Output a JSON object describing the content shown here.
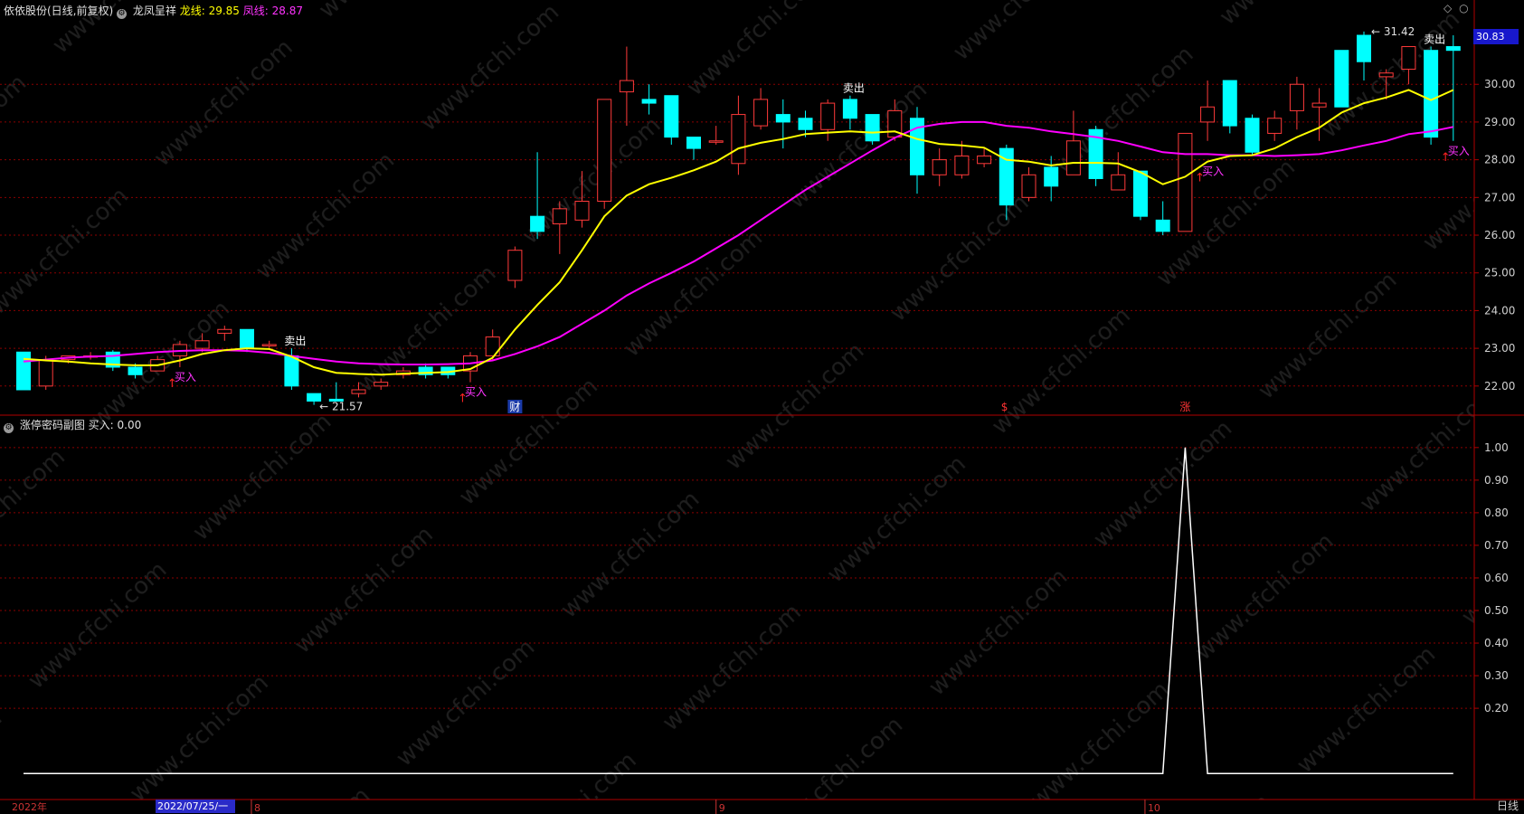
{
  "header": {
    "stock": "依依股份(日线,前复权)",
    "indicator": "龙凤呈祥",
    "dragon_label": "龙线:",
    "dragon_value": "29.85",
    "phoenix_label": "凤线:",
    "phoenix_value": "28.87"
  },
  "sub_header": {
    "indicator": "涨停密码副图",
    "buy_label": "买入:",
    "buy_value": "0.00"
  },
  "current_price": "30.83",
  "timeframe": "日线",
  "x_axis": {
    "year": "2022年",
    "cursor_date": "2022/07/25/一",
    "months": [
      "8",
      "9",
      "10"
    ]
  },
  "watermark": "www.cfchi.com",
  "colors": {
    "up": "#ff3a3a",
    "down": "#00ffff",
    "dragon": "#ffff00",
    "phoenix": "#ff00ff",
    "grid": "#8b0000",
    "signal_line": "#ffffff"
  },
  "chart_data": [
    {
      "type": "candlestick",
      "y_axis": {
        "ticks": [
          "22.00",
          "23.00",
          "24.00",
          "25.00",
          "26.00",
          "27.00",
          "28.00",
          "29.00",
          "30.00"
        ],
        "ylim": [
          21.3,
          31.9
        ]
      },
      "candles": [
        [
          22.9,
          21.9,
          22.9,
          21.9
        ],
        [
          22.0,
          22.7,
          22.8,
          21.9
        ],
        [
          22.7,
          22.8,
          22.8,
          22.6
        ],
        [
          22.8,
          22.8,
          22.9,
          22.7
        ],
        [
          22.9,
          22.5,
          22.95,
          22.4
        ],
        [
          22.5,
          22.3,
          22.6,
          22.2
        ],
        [
          22.4,
          22.7,
          22.8,
          22.4
        ],
        [
          22.8,
          23.1,
          23.2,
          22.5
        ],
        [
          23.0,
          23.2,
          23.4,
          22.9
        ],
        [
          23.4,
          23.5,
          23.6,
          23.2
        ],
        [
          23.5,
          23.0,
          23.5,
          22.9
        ],
        [
          23.1,
          23.1,
          23.2,
          23.0
        ],
        [
          22.8,
          22.0,
          23.0,
          21.9
        ],
        [
          21.8,
          21.6,
          21.8,
          21.5
        ],
        [
          21.65,
          21.6,
          22.1,
          21.6
        ],
        [
          21.8,
          21.9,
          22.1,
          21.7
        ],
        [
          22.0,
          22.1,
          22.2,
          21.9
        ],
        [
          22.3,
          22.4,
          22.5,
          22.2
        ],
        [
          22.5,
          22.3,
          22.6,
          22.2
        ],
        [
          22.5,
          22.3,
          22.5,
          22.2
        ],
        [
          22.4,
          22.8,
          22.9,
          22.1
        ],
        [
          22.8,
          23.3,
          23.5,
          22.7
        ],
        [
          24.8,
          25.6,
          25.7,
          24.6
        ],
        [
          26.5,
          26.1,
          28.2,
          25.9
        ],
        [
          26.3,
          26.7,
          26.9,
          25.5
        ],
        [
          26.4,
          26.9,
          27.7,
          26.2
        ],
        [
          26.9,
          29.6,
          29.6,
          26.7
        ],
        [
          29.8,
          30.1,
          31.0,
          28.9
        ],
        [
          29.6,
          29.5,
          30.0,
          29.2
        ],
        [
          29.7,
          28.6,
          29.7,
          28.4
        ],
        [
          28.6,
          28.3,
          28.6,
          28.0
        ],
        [
          28.5,
          28.5,
          28.9,
          28.4
        ],
        [
          27.9,
          29.2,
          29.7,
          27.6
        ],
        [
          28.9,
          29.6,
          29.9,
          28.8
        ],
        [
          29.2,
          29.0,
          29.6,
          28.3
        ],
        [
          29.1,
          28.8,
          29.3,
          28.6
        ],
        [
          28.8,
          29.5,
          29.6,
          28.5
        ],
        [
          29.6,
          29.1,
          29.7,
          28.8
        ],
        [
          29.2,
          28.5,
          29.2,
          28.4
        ],
        [
          28.6,
          29.3,
          29.6,
          28.5
        ],
        [
          29.1,
          27.6,
          29.4,
          27.1
        ],
        [
          27.6,
          28.0,
          28.3,
          27.3
        ],
        [
          27.6,
          28.1,
          28.5,
          27.5
        ],
        [
          27.9,
          28.1,
          28.3,
          27.8
        ],
        [
          28.3,
          26.8,
          28.4,
          26.4
        ],
        [
          27.0,
          27.6,
          27.8,
          26.9
        ],
        [
          27.8,
          27.3,
          28.1,
          26.9
        ],
        [
          27.6,
          28.5,
          29.3,
          27.6
        ],
        [
          28.8,
          27.5,
          28.9,
          27.3
        ],
        [
          27.2,
          27.6,
          28.2,
          27.2
        ],
        [
          27.7,
          26.5,
          27.7,
          26.4
        ],
        [
          26.4,
          26.1,
          26.9,
          26.0
        ],
        [
          26.1,
          28.7,
          28.7,
          26.1
        ],
        [
          29.0,
          29.4,
          30.1,
          28.5
        ],
        [
          30.1,
          28.9,
          30.1,
          28.7
        ],
        [
          29.1,
          28.2,
          29.2,
          28.1
        ],
        [
          28.7,
          29.1,
          29.3,
          28.5
        ],
        [
          29.3,
          30.0,
          30.2,
          28.8
        ],
        [
          29.4,
          29.5,
          29.9,
          28.5
        ],
        [
          30.9,
          29.4,
          30.9,
          29.4
        ],
        [
          31.3,
          30.6,
          31.4,
          30.1
        ],
        [
          30.2,
          30.3,
          30.4,
          29.6
        ],
        [
          30.4,
          31.0,
          31.0,
          30.0
        ],
        [
          30.9,
          28.6,
          31.0,
          28.4
        ],
        [
          31.0,
          30.9,
          31.3,
          28.5
        ]
      ],
      "dragon_line": [
        22.72,
        22.68,
        22.65,
        22.6,
        22.57,
        22.55,
        22.55,
        22.68,
        22.85,
        22.95,
        23.0,
        22.98,
        22.78,
        22.5,
        22.35,
        22.32,
        22.3,
        22.33,
        22.35,
        22.37,
        22.45,
        22.75,
        23.5,
        24.15,
        24.75,
        25.6,
        26.5,
        27.05,
        27.35,
        27.52,
        27.72,
        27.95,
        28.3,
        28.45,
        28.55,
        28.68,
        28.72,
        28.75,
        28.72,
        28.75,
        28.55,
        28.42,
        28.38,
        28.32,
        28.0,
        27.95,
        27.85,
        27.92,
        27.92,
        27.9,
        27.67,
        27.35,
        27.55,
        27.95,
        28.1,
        28.12,
        28.3,
        28.6,
        28.85,
        29.25,
        29.5,
        29.65,
        29.85,
        29.58,
        29.85
      ],
      "phoenix_line": [
        22.65,
        22.7,
        22.75,
        22.78,
        22.8,
        22.85,
        22.9,
        22.93,
        22.95,
        22.95,
        22.93,
        22.88,
        22.8,
        22.72,
        22.65,
        22.6,
        22.58,
        22.57,
        22.57,
        22.58,
        22.6,
        22.68,
        22.85,
        23.05,
        23.3,
        23.65,
        24.0,
        24.4,
        24.72,
        25.0,
        25.3,
        25.65,
        26.0,
        26.4,
        26.8,
        27.2,
        27.55,
        27.9,
        28.25,
        28.58,
        28.85,
        28.95,
        29.0,
        29.0,
        28.9,
        28.85,
        28.75,
        28.68,
        28.6,
        28.5,
        28.35,
        28.2,
        28.15,
        28.15,
        28.12,
        28.12,
        28.1,
        28.12,
        28.15,
        28.25,
        28.38,
        28.5,
        28.68,
        28.75,
        28.87
      ],
      "annotations": [
        {
          "index": 13,
          "text": "← 21.57"
        },
        {
          "index": 60,
          "text": "31.42"
        },
        {
          "index": 12,
          "text": "卖出"
        },
        {
          "index": 37,
          "text": "卖出"
        },
        {
          "index": 63,
          "text": "卖出"
        },
        {
          "index": 7,
          "text": "买入"
        },
        {
          "index": 20,
          "text": "买入"
        },
        {
          "index": 53,
          "text": "买入"
        },
        {
          "index": 64,
          "text": "买入"
        }
      ],
      "event_marks": [
        {
          "index": 22,
          "text": "财"
        },
        {
          "index": 44,
          "text": "$"
        },
        {
          "index": 52,
          "text": "涨"
        }
      ]
    },
    {
      "type": "line",
      "y_axis": {
        "ticks": [
          "0.20",
          "0.30",
          "0.40",
          "0.50",
          "0.60",
          "0.70",
          "0.80",
          "0.90",
          "1.00"
        ],
        "ylim": [
          -0.08,
          1.08
        ]
      },
      "series": [
        {
          "name": "买入",
          "values": [
            0,
            0,
            0,
            0,
            0,
            0,
            0,
            0,
            0,
            0,
            0,
            0,
            0,
            0,
            0,
            0,
            0,
            0,
            0,
            0,
            0,
            0,
            0,
            0,
            0,
            0,
            0,
            0,
            0,
            0,
            0,
            0,
            0,
            0,
            0,
            0,
            0,
            0,
            0,
            0,
            0,
            0,
            0,
            0,
            0,
            0,
            0,
            0,
            0,
            0,
            0,
            0,
            1,
            0,
            0,
            0,
            0,
            0,
            0,
            0,
            0,
            0,
            0,
            0,
            0
          ]
        }
      ]
    }
  ]
}
